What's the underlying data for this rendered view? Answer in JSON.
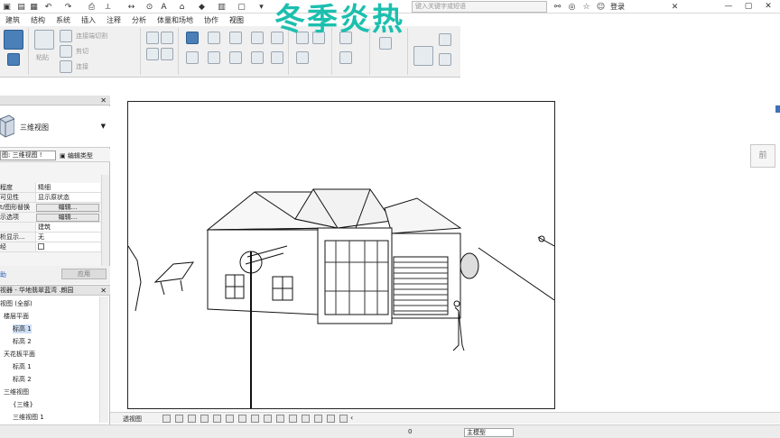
{
  "titlebar": {
    "search_placeholder": "键入关键字或短语",
    "login_label": "登录"
  },
  "ribbon": {
    "tabs": [
      "建筑",
      "结构",
      "系统",
      "插入",
      "注释",
      "分析",
      "体量和场地",
      "协作",
      "视图"
    ],
    "labels": {
      "paste": "粘贴",
      "cut": "剪切",
      "join": "连接",
      "match": "连接端切割"
    }
  },
  "watermark": "冬季炎热",
  "properties": {
    "type_name": "三维视图",
    "view_selector": "图: 三维视图 ! ",
    "edit_type": "编辑类型",
    "rows": [
      {
        "key": "程度",
        "value": "精细",
        "button": false
      },
      {
        "key": "可见性",
        "value": "显示原状态",
        "button": false
      },
      {
        "key": "t/图形替换",
        "value": "编辑...",
        "button": true
      },
      {
        "key": "示选项",
        "value": "编辑...",
        "button": true
      },
      {
        "key": "",
        "value": "建筑",
        "button": false
      },
      {
        "key": "析显示...",
        "value": "无",
        "button": false
      },
      {
        "key": "经",
        "value": "",
        "button": false
      }
    ],
    "help_label": "助",
    "apply_label": "应用"
  },
  "browser": {
    "title": "视器 - 华地翡翠蓝湾 .朗园",
    "items": [
      {
        "label": "视图 (全部)",
        "indent": 0,
        "selected": false
      },
      {
        "label": "楼层平面",
        "indent": 1,
        "selected": false
      },
      {
        "label": "标高 1",
        "indent": 2,
        "selected": true
      },
      {
        "label": "标高 2",
        "indent": 2,
        "selected": false
      },
      {
        "label": "天花板平面",
        "indent": 1,
        "selected": false
      },
      {
        "label": "标高 1",
        "indent": 2,
        "selected": false
      },
      {
        "label": "标高 2",
        "indent": 2,
        "selected": false
      },
      {
        "label": "三维视图",
        "indent": 1,
        "selected": false
      },
      {
        "label": "{三维}",
        "indent": 2,
        "selected": false
      },
      {
        "label": "三维视图 1",
        "indent": 2,
        "selected": false
      }
    ]
  },
  "viewcube_label": "前",
  "viewbar": {
    "scale": "透视图"
  },
  "statusbar": {
    "zero": "0",
    "model": "主模型"
  }
}
